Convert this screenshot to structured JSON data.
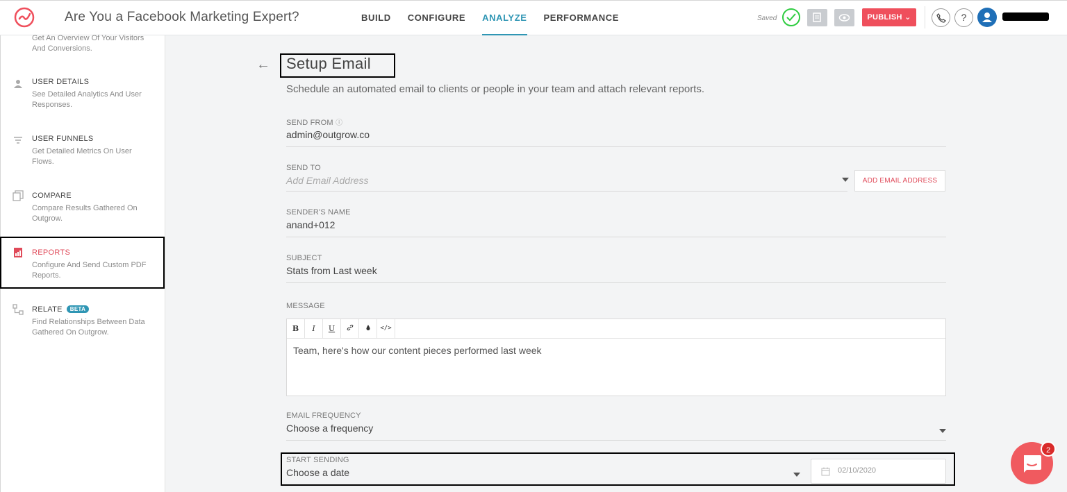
{
  "header": {
    "title": "Are You a Facebook Marketing Expert?",
    "nav": [
      {
        "label": "BUILD",
        "active": false
      },
      {
        "label": "CONFIGURE",
        "active": false
      },
      {
        "label": "ANALYZE",
        "active": true
      },
      {
        "label": "PERFORMANCE",
        "active": false
      }
    ],
    "saved_label": "Saved",
    "publish_label": "PUBLISH",
    "help_label": "?",
    "accent_color": "#2f96b4",
    "publish_color": "#ef4f5c"
  },
  "sidebar": {
    "items": [
      {
        "title": "",
        "desc": "Get An Overview Of Your Visitors And Conversions.",
        "icon": "overview-icon"
      },
      {
        "title": "USER DETAILS",
        "desc": "See Detailed Analytics And User Responses.",
        "icon": "user-icon"
      },
      {
        "title": "USER FUNNELS",
        "desc": "Get Detailed Metrics On User Flows.",
        "icon": "filter-icon"
      },
      {
        "title": "COMPARE",
        "desc": "Compare Results Gathered On Outgrow.",
        "icon": "compare-icon"
      },
      {
        "title": "REPORTS",
        "desc": "Configure And Send Custom PDF Reports.",
        "icon": "report-icon",
        "active": true
      },
      {
        "title": "RELATE",
        "desc": "Find Relationships Between Data Gathered On Outgrow.",
        "icon": "relate-icon",
        "badge": "BETA"
      }
    ]
  },
  "main": {
    "title": "Setup Email",
    "subtitle": "Schedule an automated email to clients or people in your team and attach relevant reports.",
    "send_from": {
      "label": "SEND FROM",
      "value": "admin@outgrow.co"
    },
    "send_to": {
      "label": "SEND TO",
      "placeholder": "Add Email Address",
      "button": "ADD EMAIL ADDRESS"
    },
    "sender_name": {
      "label": "SENDER'S NAME",
      "value": "anand+012"
    },
    "subject": {
      "label": "SUBJECT",
      "value": "Stats from Last week"
    },
    "message": {
      "label": "MESSAGE",
      "toolbar": [
        "B",
        "I",
        "U",
        "link",
        "color",
        "</>"
      ],
      "text": "Team, here's how our content pieces performed last week"
    },
    "frequency": {
      "label": "EMAIL FREQUENCY",
      "value": "Choose a frequency"
    },
    "start": {
      "label": "START SENDING",
      "value": "Choose a date",
      "date": "02/10/2020"
    }
  },
  "chat": {
    "badge": "2"
  }
}
